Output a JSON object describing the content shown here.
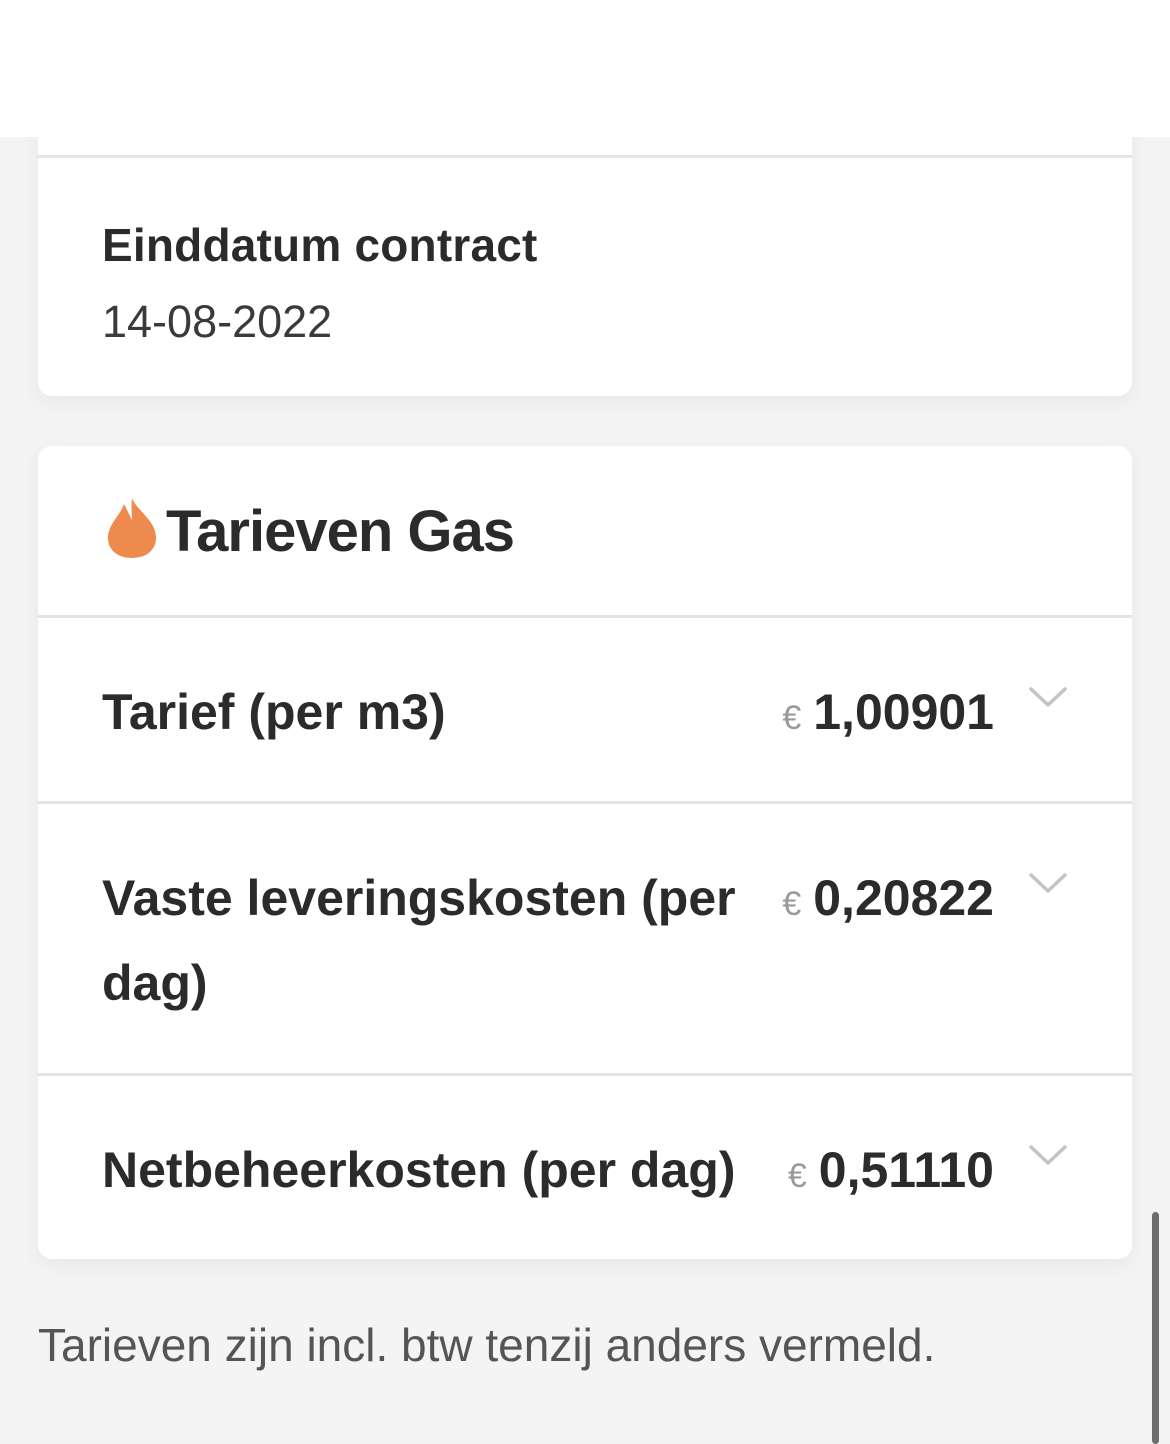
{
  "contract": {
    "end_date_label": "Einddatum contract",
    "end_date_value": "14-08-2022"
  },
  "gas": {
    "title": "Tarieven Gas",
    "icon": "flame-icon",
    "icon_color": "#ef8a4f",
    "currency_symbol": "€",
    "rows": [
      {
        "label": "Tarief (per m3)",
        "value": "1,00901"
      },
      {
        "label": "Vaste leveringskosten (per dag)",
        "value": "0,20822"
      },
      {
        "label": "Netbeheerkosten (per dag)",
        "value": "0,51110"
      }
    ]
  },
  "footnote": "Tarieven zijn incl. btw tenzij anders vermeld."
}
